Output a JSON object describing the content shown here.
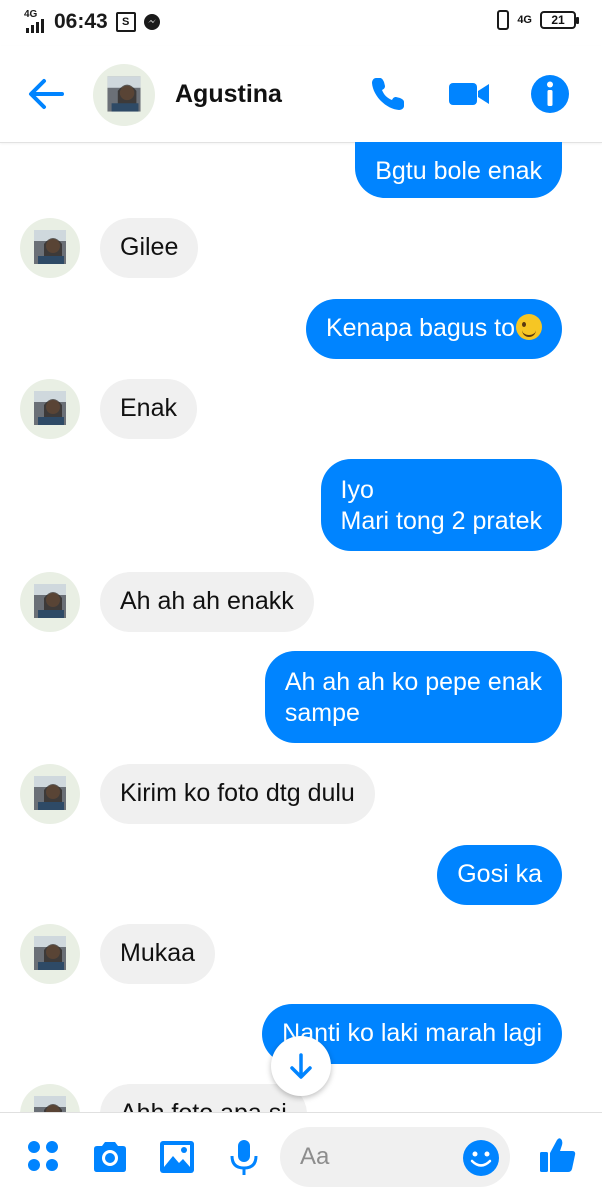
{
  "status_bar": {
    "time": "06:43",
    "network_left": "4G",
    "network_right": "4G",
    "battery": "21"
  },
  "header": {
    "contact_name": "Agustina"
  },
  "messages": [
    {
      "direction": "outgoing",
      "text": "Bgtu bole enak"
    },
    {
      "direction": "incoming",
      "text": "Gilee"
    },
    {
      "direction": "outgoing",
      "text": "Kenapa bagus to",
      "emoji": "winking-face"
    },
    {
      "direction": "incoming",
      "text": "Enak"
    },
    {
      "direction": "outgoing",
      "lines": [
        "Iyo",
        "Mari tong 2 pratek"
      ]
    },
    {
      "direction": "incoming",
      "text": "Ah ah ah enakk"
    },
    {
      "direction": "outgoing",
      "lines": [
        "Ah ah ah ko pepe enak",
        "sampe"
      ]
    },
    {
      "direction": "incoming",
      "text": "Kirim ko foto dtg dulu"
    },
    {
      "direction": "outgoing",
      "text": "Gosi ka"
    },
    {
      "direction": "incoming",
      "text": "Mukaa"
    },
    {
      "direction": "outgoing",
      "text": "Nanti ko laki marah lagi"
    },
    {
      "direction": "incoming",
      "text": "Ahh foto apa si"
    }
  ],
  "composer": {
    "placeholder": "Aa"
  },
  "colors": {
    "accent": "#0084ff",
    "incoming_bubble": "#f0f0f0",
    "outgoing_text": "#ffffff"
  },
  "icons": {
    "header": [
      "back-arrow-icon",
      "phone-icon",
      "video-camera-icon",
      "info-icon"
    ],
    "composer": [
      "more-dots-icon",
      "camera-icon",
      "gallery-icon",
      "microphone-icon",
      "emoji-icon",
      "thumbs-up-icon"
    ]
  }
}
